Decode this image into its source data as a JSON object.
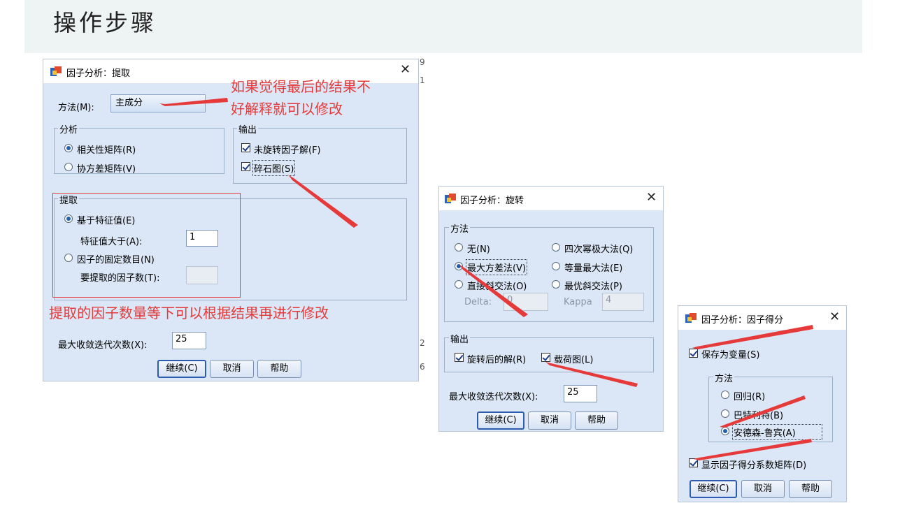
{
  "slide": {
    "title": "操作步骤"
  },
  "extract": {
    "title": "因子分析：提取",
    "method_label": "方法(M):",
    "method_value": "主成分",
    "analysis_legend": "分析",
    "analysis_options": [
      "相关性矩阵(R)",
      "协方差矩阵(V)"
    ],
    "output_legend": "输出",
    "output_options": [
      "未旋转因子解(F)",
      "碎石图(S)"
    ],
    "extract_legend": "提取",
    "eigen_radio": "基于特征值(E)",
    "eigen_label": "特征值大于(A):",
    "eigen_value": "1",
    "fixed_radio": "因子的固定数目(N)",
    "fixed_label": "要提取的因子数(T):",
    "fixed_value": "",
    "iter_label": "最大收敛迭代次数(X):",
    "iter_value": "25",
    "buttons": {
      "continue": "继续(C)",
      "cancel": "取消",
      "help": "帮助"
    },
    "strip_chars": [
      "9",
      "1",
      "2",
      "6"
    ]
  },
  "rotation": {
    "title": "因子分析：旋转",
    "method_legend": "方法",
    "methods": [
      "无(N)",
      "四次幂极大法(Q)",
      "最大方差法(V)",
      "等量最大法(E)",
      "直接斜交法(O)",
      "最优斜交法(P)"
    ],
    "delta_label": "Delta:",
    "delta_value": "0",
    "kappa_label": "Kappa",
    "kappa_value": "4",
    "output_legend": "输出",
    "output_options": [
      "旋转后的解(R)",
      "载荷图(L)"
    ],
    "iter_label": "最大收敛迭代次数(X):",
    "iter_value": "25",
    "buttons": {
      "continue": "继续(C)",
      "cancel": "取消",
      "help": "帮助"
    }
  },
  "scores": {
    "title": "因子分析：因子得分",
    "save_label": "保存为变量(S)",
    "method_legend": "方法",
    "methods": [
      "回归(R)",
      "巴特利特(B)",
      "安德森-鲁宾(A)"
    ],
    "display_label": "显示因子得分系数矩阵(D)",
    "buttons": {
      "continue": "继续(C)",
      "cancel": "取消",
      "help": "帮助"
    }
  },
  "annotations": {
    "method_note_line1": "如果觉得最后的结果不",
    "method_note_line2": "好解释就可以修改",
    "extract_note": "提取的因子数量等下可以根据结果再进行修改"
  },
  "colors": {
    "annotation": "#e63a3a",
    "dialog_bg": "#dbe7f6",
    "banner": "#eef4f3"
  },
  "icons": [
    "spss-app-icon",
    "close-icon",
    "radio-icon",
    "checkbox-icon",
    "red-arrow-icon"
  ]
}
